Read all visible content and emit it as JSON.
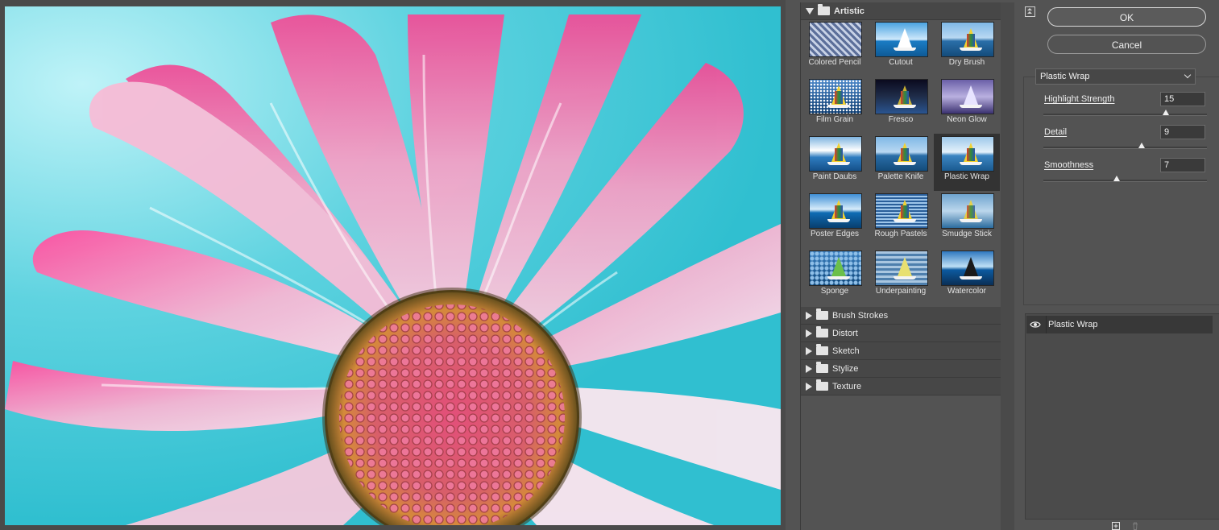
{
  "dialog": {
    "ok_label": "OK",
    "cancel_label": "Cancel"
  },
  "gallery": {
    "groups": [
      {
        "label": "Artistic",
        "expanded": true
      },
      {
        "label": "Brush Strokes",
        "expanded": false
      },
      {
        "label": "Distort",
        "expanded": false
      },
      {
        "label": "Sketch",
        "expanded": false
      },
      {
        "label": "Stylize",
        "expanded": false
      },
      {
        "label": "Texture",
        "expanded": false
      }
    ],
    "artistic_filters": [
      {
        "label": "Colored Pencil"
      },
      {
        "label": "Cutout"
      },
      {
        "label": "Dry Brush"
      },
      {
        "label": "Film Grain"
      },
      {
        "label": "Fresco"
      },
      {
        "label": "Neon Glow"
      },
      {
        "label": "Paint Daubs"
      },
      {
        "label": "Palette Knife"
      },
      {
        "label": "Plastic Wrap",
        "selected": true
      },
      {
        "label": "Poster Edges"
      },
      {
        "label": "Rough Pastels"
      },
      {
        "label": "Smudge Stick"
      },
      {
        "label": "Sponge"
      },
      {
        "label": "Underpainting"
      },
      {
        "label": "Watercolor"
      }
    ]
  },
  "settings": {
    "selected_filter": "Plastic Wrap",
    "params": [
      {
        "label": "Highlight Strength",
        "value": "15",
        "fraction": 0.75
      },
      {
        "label": "Detail",
        "value": "9",
        "fraction": 0.6
      },
      {
        "label": "Smoothness",
        "value": "7",
        "fraction": 0.45
      }
    ]
  },
  "layers": {
    "items": [
      {
        "label": "Plastic Wrap",
        "visible": true
      }
    ]
  },
  "icons": {
    "collapse": "collapse-panel-icon",
    "eye": "eye-icon",
    "new_layer": "new-effect-layer-icon",
    "delete": "trash-icon",
    "folder": "folder-icon"
  },
  "colors": {
    "panel_bg": "#535353",
    "selected_thumb_bg": "#333333",
    "petal_pink": "#f06aa8",
    "sky_cyan": "#30bfd0"
  }
}
